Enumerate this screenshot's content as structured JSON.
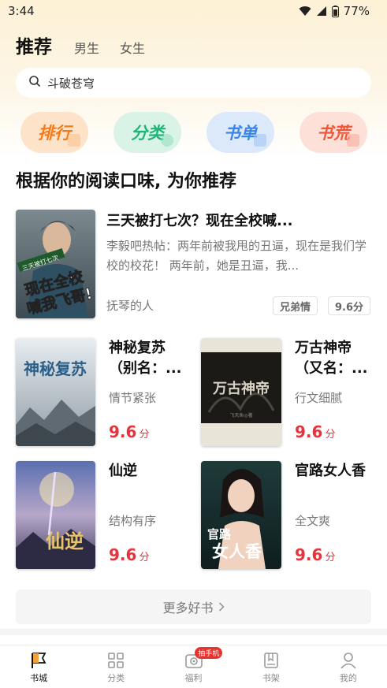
{
  "status_bar": {
    "time": "3:44",
    "battery": "77%"
  },
  "header": {
    "tabs": [
      {
        "label": "推荐",
        "active": true
      },
      {
        "label": "男生"
      },
      {
        "label": "女生"
      }
    ]
  },
  "search": {
    "value": "斗破苍穹"
  },
  "chips": [
    {
      "label": "排行",
      "color": "#f47a1a"
    },
    {
      "label": "分类",
      "color": "#1fb577"
    },
    {
      "label": "书单",
      "color": "#3a86e8"
    },
    {
      "label": "书荒",
      "color": "#f0573a"
    }
  ],
  "section": {
    "title": "根据你的阅读口味, 为你推荐"
  },
  "featured": {
    "title": "三天被打七次？现在全校喊...",
    "desc": "李毅吧热帖：两年前被我甩的丑逼，现在是我们学校的校花！ 两年前，她是丑逼，我...",
    "author": "抚琴的人",
    "tags": [
      "兄弟情",
      "9.6分"
    ],
    "cover_text": [
      "现在全校",
      "喊我飞哥!"
    ],
    "cover_top": "三天被打七次"
  },
  "grid": [
    {
      "title": "神秘复苏（别名：...",
      "tag": "情节紧张",
      "score": "9.6",
      "unit": "分",
      "cover_text": "神秘复苏"
    },
    {
      "title": "万古神帝（又名：...",
      "tag": "行文细腻",
      "score": "9.6",
      "unit": "分",
      "cover_text": "万古神帝",
      "cover_author": "飞天鱼◎著"
    },
    {
      "title": "仙逆",
      "tag": "结构有序",
      "score": "9.6",
      "unit": "分",
      "cover_text": "仙逆"
    },
    {
      "title": "官路女人香",
      "tag": "全文爽",
      "score": "9.6",
      "unit": "分",
      "cover_text": [
        "官路",
        "女人香"
      ]
    }
  ],
  "more": {
    "label": "更多好书"
  },
  "bottom_nav": {
    "items": [
      {
        "label": "书城",
        "icon": "flag-icon",
        "active": true
      },
      {
        "label": "分类",
        "icon": "grid-icon"
      },
      {
        "label": "福利",
        "icon": "gift-icon",
        "badge": "抽手机"
      },
      {
        "label": "书架",
        "icon": "book-icon"
      },
      {
        "label": "我的",
        "icon": "user-icon"
      }
    ]
  }
}
